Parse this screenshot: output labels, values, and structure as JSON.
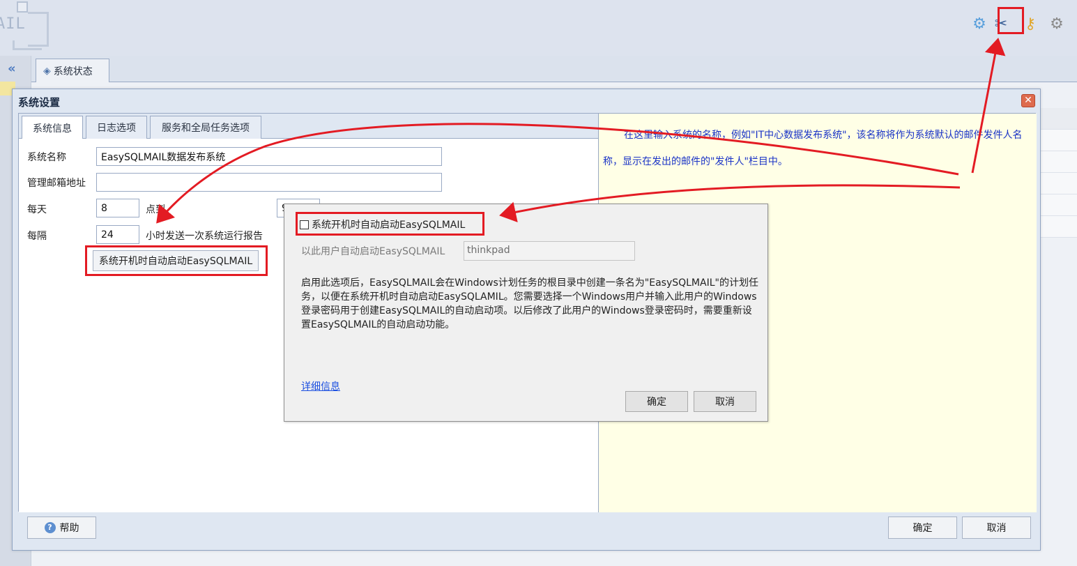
{
  "app": {
    "logo_text": "AIL",
    "main_tab_label": "系统状态",
    "toolbar_icons": [
      "gear-blue-icon",
      "tools-icon",
      "key-icon",
      "gear-icon"
    ]
  },
  "settings_window": {
    "title": "系统设置",
    "tabs": [
      {
        "label": "系统信息",
        "active": true
      },
      {
        "label": "日志选项",
        "active": false
      },
      {
        "label": "服务和全局任务选项",
        "active": false
      }
    ],
    "fields": {
      "system_name_label": "系统名称",
      "system_name_value": "EasySQLMAIL数据发布系统",
      "admin_email_label": "管理邮箱地址",
      "admin_email_value": "",
      "daily_label": "每天",
      "daily_value": "8",
      "point_label": "点到",
      "point_value": "9",
      "interval_label": "每隔",
      "interval_value": "24",
      "interval_suffix": "小时发送一次系统运行报告"
    },
    "autostart_button": "系统开机时自动启动EasySQLMAIL",
    "help_text": "在这里输入系统的名称，例如\"IT中心数据发布系统\"，该名称将作为系统默认的邮件发件人名称，显示在发出的邮件的\"发件人\"栏目中。",
    "help_button": "帮助",
    "ok_button": "确定",
    "cancel_button": "取消"
  },
  "autostart_dialog": {
    "checkbox_label": "系统开机时自动启动EasySQLMAIL",
    "checkbox_checked": false,
    "user_label": "以此用户自动启动EasySQLMAIL",
    "user_value": "thinkpad",
    "description": "启用此选项后，EasySQLMAIL会在Windows计划任务的根目录中创建一条名为\"EasySQLMAIL\"的计划任务，以便在系统开机时自动启动EasySQLAMIL。您需要选择一个Windows用户并输入此用户的Windows登录密码用于创建EasySQLMAIL的自动启动项。以后修改了此用户的Windows登录密码时，需要重新设置EasySQLMAIL的自动启动功能。",
    "details_link": "详细信息",
    "ok_button": "确定",
    "cancel_button": "取消"
  },
  "colors": {
    "annotation_red": "#e31b23",
    "help_text_blue": "#1a33c6",
    "help_bg": "#ffffe6"
  }
}
